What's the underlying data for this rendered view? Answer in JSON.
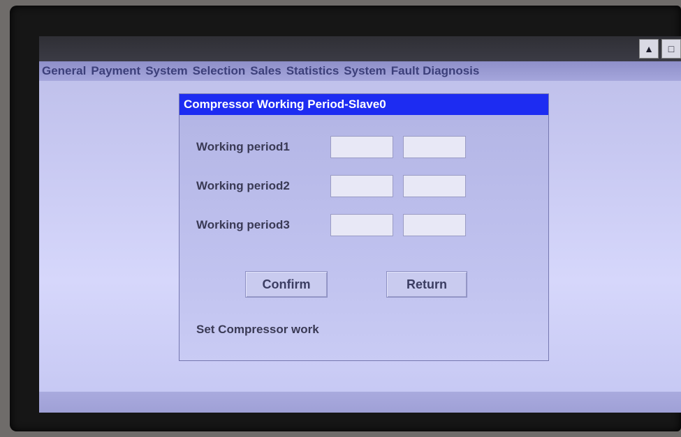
{
  "titlebar": {
    "scroll_up_icon": "triangle-up-icon",
    "window_icon": "square-icon"
  },
  "menu": {
    "items": [
      {
        "label": "General"
      },
      {
        "label": "Payment"
      },
      {
        "label": "System"
      },
      {
        "label": "Selection"
      },
      {
        "label": "Sales"
      },
      {
        "label": "Statistics"
      },
      {
        "label": "System"
      },
      {
        "label": "Fault Diagnosis"
      }
    ]
  },
  "dialog": {
    "title": "Compressor Working Period-Slave0",
    "rows": [
      {
        "label": "Working period1",
        "start": "",
        "end": ""
      },
      {
        "label": "Working period2",
        "start": "",
        "end": ""
      },
      {
        "label": "Working period3",
        "start": "",
        "end": ""
      }
    ],
    "confirm_label": "Confirm",
    "return_label": "Return",
    "status_text": "Set Compressor work"
  },
  "colors": {
    "title_bar": "#1d2cf2",
    "menu_text": "#3c3f7a",
    "screen_bg": "#c7c8f1"
  }
}
